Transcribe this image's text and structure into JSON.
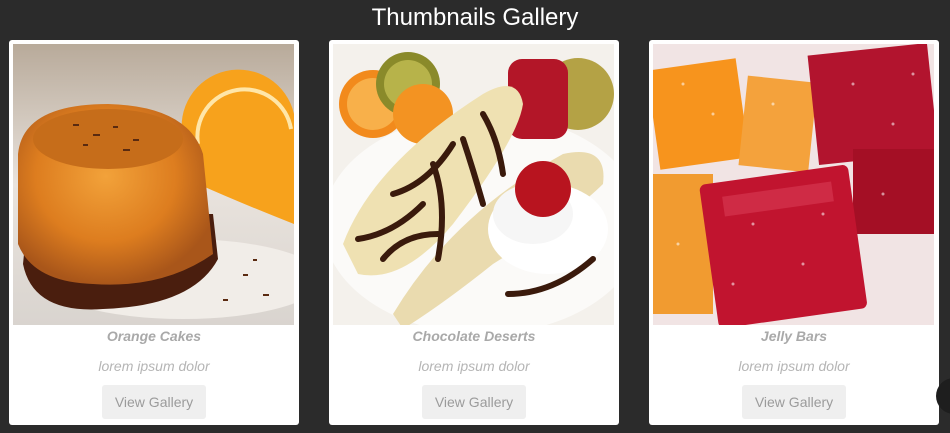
{
  "page": {
    "title": "Thumbnails Gallery"
  },
  "cards": [
    {
      "name": "Orange Cakes",
      "description": "lorem ipsum dolor",
      "button_label": "View Gallery",
      "image": "orange-cake-image"
    },
    {
      "name": "Chocolate Deserts",
      "description": "lorem ipsum dolor",
      "button_label": "View Gallery",
      "image": "banana-chocolate-dessert-image"
    },
    {
      "name": "Jelly Bars",
      "description": "lorem ipsum dolor",
      "button_label": "View Gallery",
      "image": "jelly-bars-image"
    }
  ],
  "colors": {
    "background": "#2b2b2b",
    "card": "#ffffff",
    "text_muted": "#a9a9a9",
    "button_bg": "#efefef"
  }
}
